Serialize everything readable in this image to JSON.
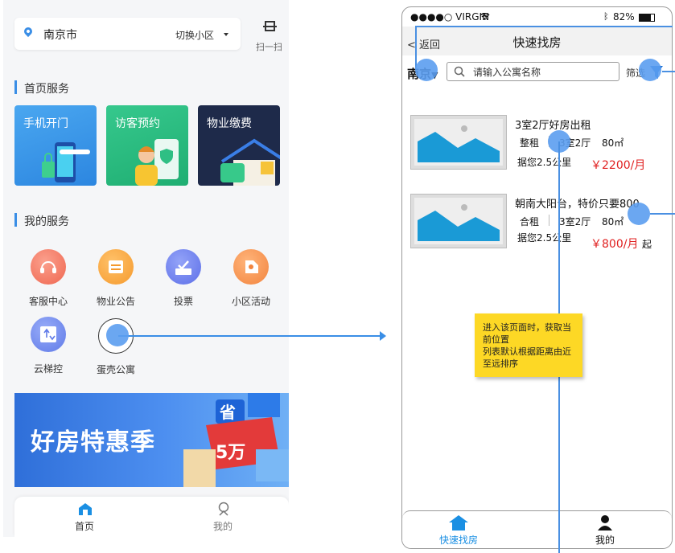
{
  "left_app": {
    "location": {
      "city": "南京市",
      "switch_label": "切换小区",
      "scan_label": "扫一扫"
    },
    "home_services": {
      "title": "首页服务",
      "cards": [
        {
          "label": "手机开门",
          "color": "#3d9ae8"
        },
        {
          "label": "访客预约",
          "color": "#2fbf84"
        },
        {
          "label": "物业缴费",
          "color": "#1e2a4a"
        }
      ]
    },
    "my_services": {
      "title": "我的服务",
      "items": [
        {
          "label": "客服中心",
          "icon": "headset-icon",
          "color": "#f26b55"
        },
        {
          "label": "物业公告",
          "icon": "notice-icon",
          "color": "#f7a23a"
        },
        {
          "label": "投票",
          "icon": "vote-icon",
          "color": "#6a7ef0"
        },
        {
          "label": "小区活动",
          "icon": "activity-icon",
          "color": "#f58b45"
        },
        {
          "label": "云梯控",
          "icon": "elevator-icon",
          "color": "#6d88f2"
        },
        {
          "label": "蛋壳公寓",
          "icon": "apartment-icon",
          "color": "#5b9df0"
        }
      ]
    },
    "banner": {
      "text": "好房特惠季",
      "badge": "5万",
      "tag": "省"
    },
    "tabbar": [
      {
        "label": "首页",
        "active": true
      },
      {
        "label": "我的",
        "active": false
      }
    ]
  },
  "right_app": {
    "status": {
      "carrier": "●●●●○ VIRGIN",
      "battery": "82%"
    },
    "nav": {
      "back": "< 返回",
      "title": "快速找房"
    },
    "search": {
      "city": "南京",
      "placeholder": "请输入公寓名称",
      "filter_label": "筛选"
    },
    "listings": [
      {
        "title": "3室2厅好房出租",
        "type": "整租",
        "layout": "3室2厅",
        "area": "80㎡",
        "distance": "据您2.5公里",
        "price": "￥2200/月",
        "suffix": ""
      },
      {
        "title": "朝南大阳台，特价只要800",
        "type": "合租",
        "layout": "3室2厅",
        "area": "80㎡",
        "distance": "据您2.5公里",
        "price": "￥800/月",
        "suffix": "起"
      }
    ],
    "note": "进入该页面时，获取当前位置\n列表默认根据距离由近至远排序",
    "tabbar": [
      {
        "label": "快速找房",
        "active": true,
        "color": "#1a8fe3"
      },
      {
        "label": "我的",
        "active": false,
        "color": "#111"
      }
    ]
  }
}
